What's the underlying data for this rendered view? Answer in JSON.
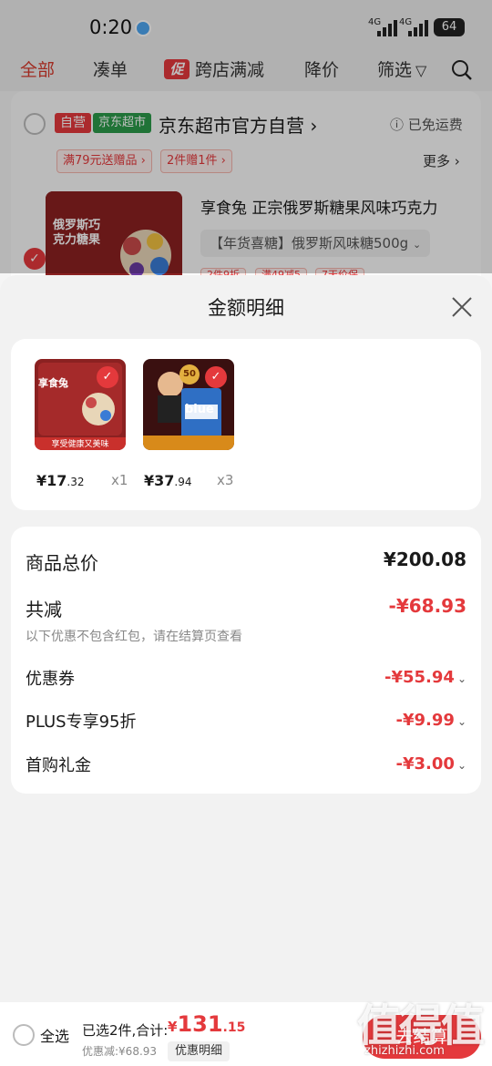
{
  "status_bar": {
    "time": "0:20",
    "network_1": "4G",
    "network_2": "4G",
    "battery": "64"
  },
  "tabs": [
    {
      "label": "全部"
    },
    {
      "label": "凑单"
    },
    {
      "label": "跨店满减",
      "badge": "促"
    },
    {
      "label": "降价"
    },
    {
      "label": "筛选"
    }
  ],
  "store": {
    "self_badge": "自营",
    "market_badge": "京东超市",
    "name": "京东超市官方自营",
    "name_chevron": "›",
    "free_shipping": "已免运费",
    "promos": [
      "满79元送赠品",
      "2件赠1件"
    ],
    "more": "更多"
  },
  "product": {
    "title": "享食兔 正宗俄罗斯糖果风味巧克力",
    "spec": "【年货喜糖】俄罗斯风味糖500g",
    "image_text": "俄罗斯巧克力糖果",
    "peek_tags": [
      "2件9折",
      "满49减5",
      "7天价保"
    ]
  },
  "sheet": {
    "title": "金额明细",
    "items": [
      {
        "price_int": "¥17",
        "price_dec": ".32",
        "qty": "x1",
        "caption": "享受健康又美味",
        "brand": "享食兔"
      },
      {
        "price_int": "¥37",
        "price_dec": ".94",
        "qty": "x3",
        "caption": "blue",
        "badge": "50"
      }
    ],
    "rows": {
      "subtotal_label": "商品总价",
      "subtotal_value": "¥200.08",
      "reduction_label": "共减",
      "reduction_value": "-¥68.93",
      "note": "以下优惠不包含红包，请在结算页查看",
      "coupon_label": "优惠券",
      "coupon_value": "-¥55.94",
      "plus_label": "PLUS专享95折",
      "plus_value": "-¥9.99",
      "gift_label": "首购礼金",
      "gift_value": "-¥3.00"
    }
  },
  "bottom": {
    "select_all": "全选",
    "selected": "已选2件,合计:",
    "total_symbol": "¥",
    "total_int": "131",
    "total_dec": ".15",
    "discount": "优惠减:¥68.93",
    "detail_button": "优惠明细",
    "checkout": "去结算"
  },
  "watermark": {
    "text": "值得值",
    "url": "zhizhizhi.com"
  },
  "colors": {
    "accent": "#e4393c",
    "green": "#2b9a4a"
  }
}
